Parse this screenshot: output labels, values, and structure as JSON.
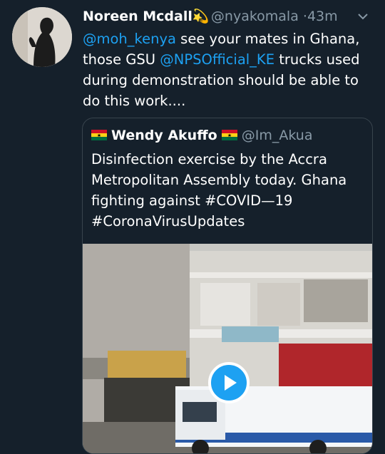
{
  "tweet": {
    "author_name": "Noreen Mcdall",
    "author_emoji": "💫",
    "handle": "@nyakomala",
    "separator": "·",
    "time": "43m",
    "text_parts": [
      {
        "type": "mention",
        "text": "@moh_kenya"
      },
      {
        "type": "text",
        "text": " see your mates in Ghana, those GSU "
      },
      {
        "type": "mention",
        "text": "@NPSOfficial_KE"
      },
      {
        "type": "text",
        "text": " trucks used during demonstration should be able to do this work...."
      }
    ]
  },
  "quoted": {
    "author_name": "Wendy Akuffo",
    "handle": "@Im_Akua",
    "text": "Disinfection exercise by the Accra Metropolitan Assembly today. Ghana fighting against #COVID—19 #CoronaVirusUpdates"
  },
  "icons": {
    "more": "chevron-down-icon",
    "play": "play-icon",
    "flag": "ghana-flag-icon"
  },
  "colors": {
    "background": "#15202b",
    "link": "#1da1f2",
    "muted": "#8899a6"
  }
}
